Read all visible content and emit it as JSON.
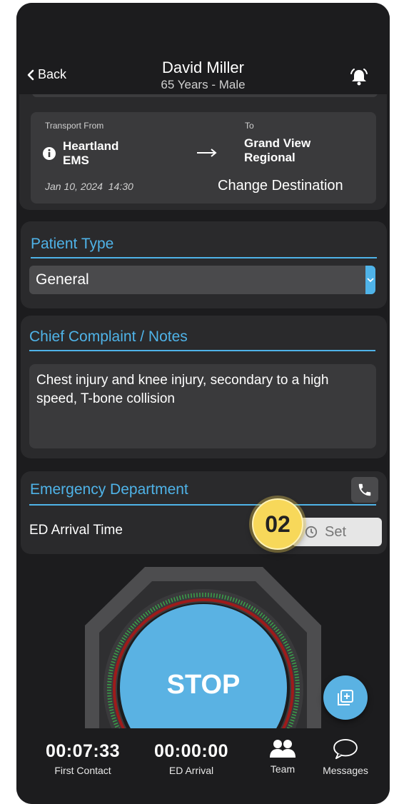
{
  "header": {
    "back_label": "Back",
    "patient_name": "David Miller",
    "patient_info": "65 Years - Male"
  },
  "transport": {
    "from_label": "Transport From",
    "from_name": "Heartland EMS",
    "to_label": "To",
    "to_name": "Grand View Regional",
    "datetime": "Jan 10, 2024  14:30",
    "change_destination": "Change Destination"
  },
  "patient_type": {
    "title": "Patient Type",
    "selected": "General"
  },
  "complaint": {
    "title": "Chief Complaint / Notes",
    "text": "Chest injury and knee injury, secondary to a high speed, T-bone collision"
  },
  "ed": {
    "title": "Emergency Department",
    "arrival_label": "ED Arrival Time",
    "set_label": "Set",
    "step_badge": "02"
  },
  "stop_button": {
    "label": "STOP"
  },
  "footer": {
    "first_contact_time": "00:07:33",
    "first_contact_label": "First Contact",
    "ed_arrival_time": "00:00:00",
    "ed_arrival_label": "ED Arrival",
    "team_label": "Team",
    "messages_label": "Messages"
  },
  "colors": {
    "accent": "#4fb3e8",
    "background": "#1c1c1e",
    "card": "#2a2a2c",
    "stop_button": "#5ab2e3",
    "badge": "#f7d85a"
  }
}
